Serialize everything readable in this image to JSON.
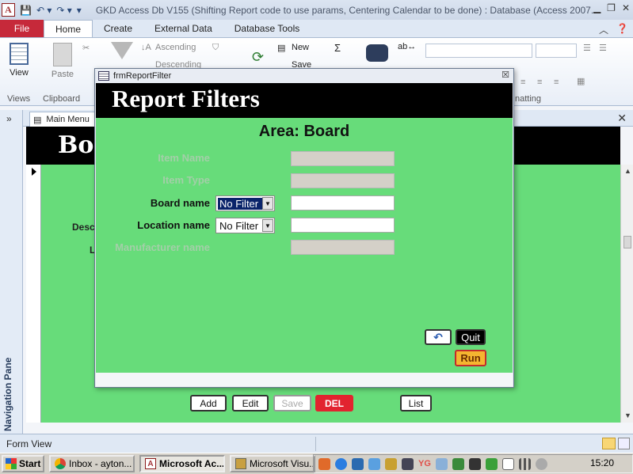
{
  "window": {
    "title": "GKD Access Db V155 (Shifting Report code to use params, Centering Calendar to be done) : Database (Access 2007...",
    "app_icon_letter": "A"
  },
  "ribbon": {
    "tabs": [
      {
        "label": "File"
      },
      {
        "label": "Home"
      },
      {
        "label": "Create"
      },
      {
        "label": "External Data"
      },
      {
        "label": "Database Tools"
      }
    ],
    "view_label": "View",
    "paste_label": "Paste",
    "ascending_label": "Ascending",
    "descending_label": "Descending",
    "new_label": "New",
    "save_label": "Save",
    "groups": {
      "views": "Views",
      "clipboard": "Clipboard",
      "formatting": "natting"
    }
  },
  "nav_pane": {
    "label": "Navigation Pane",
    "toggle": "»"
  },
  "main_menu": {
    "tab_label": "Main Menu",
    "header_title": "Boa",
    "labels": {
      "desc": "Desc",
      "l": "L"
    },
    "buttons": {
      "add": "Add",
      "edit": "Edit",
      "save": "Save",
      "del": "DEL",
      "list": "List"
    }
  },
  "dialog": {
    "title": "frmReportFilter",
    "close": "☒",
    "heading": "Report Filters",
    "area_title": "Area: Board",
    "fields": [
      {
        "label": "Item Name",
        "enabled": false
      },
      {
        "label": "Item Type",
        "enabled": false
      },
      {
        "label": "Board name",
        "enabled": true,
        "combo_value": "No Filter",
        "selected": true
      },
      {
        "label": "Location name",
        "enabled": true,
        "combo_value": "No Filter",
        "selected": false
      },
      {
        "label": "Manufacturer name",
        "enabled": false
      }
    ],
    "buttons": {
      "undo": "↶",
      "quit": "Quit",
      "run": "Run"
    }
  },
  "status_bar": {
    "text": "Form View"
  },
  "taskbar": {
    "start": "Start",
    "tasks": [
      {
        "label": "Inbox - ayton...",
        "active": false
      },
      {
        "label": "Microsoft Ac...",
        "active": true
      },
      {
        "label": "Microsoft Visu...",
        "active": false
      }
    ],
    "tray_yg": "YG",
    "clock": "15:20"
  }
}
